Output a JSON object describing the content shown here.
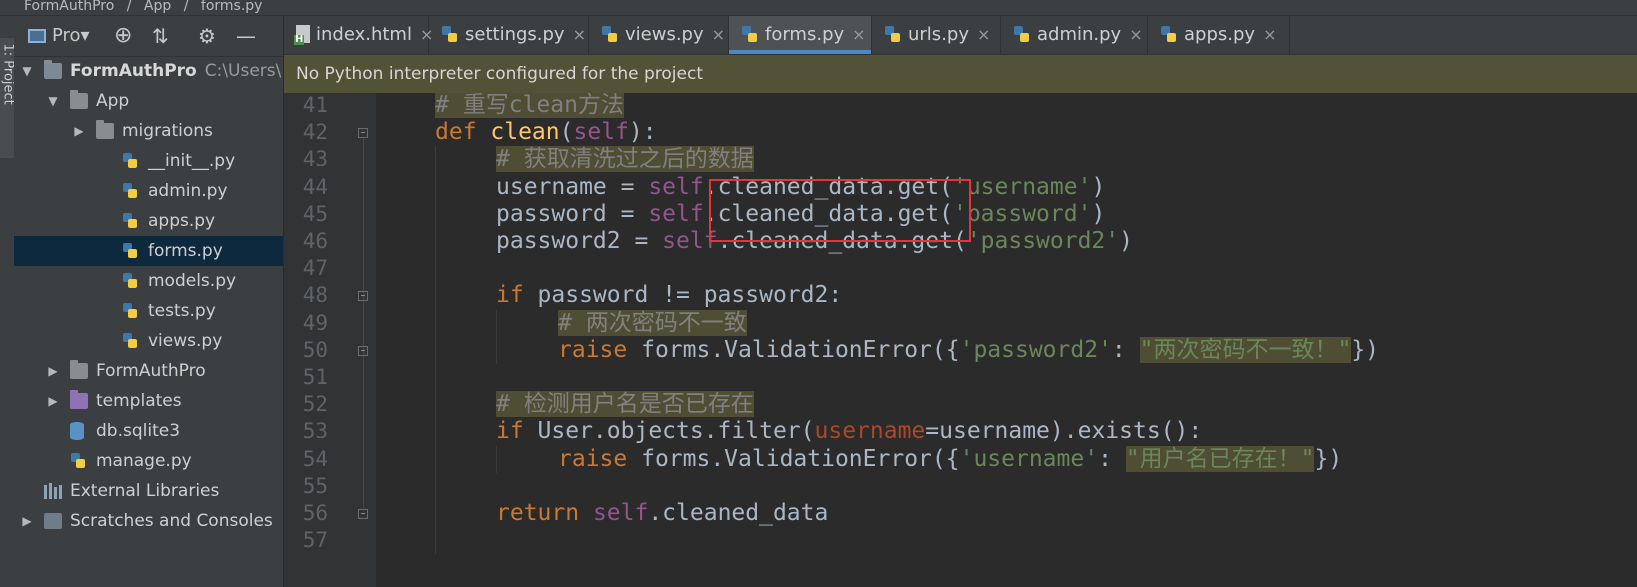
{
  "window": {
    "crumbs": [
      "FormAuthPro",
      "/",
      "App",
      "/",
      "forms.py"
    ]
  },
  "tool_window": {
    "label": "1: Project"
  },
  "sidebar": {
    "view_selector": "Pro▾",
    "tree": [
      {
        "label": "FormAuthPro",
        "suffix": "C:\\Users\\",
        "type": "folder-module",
        "arrow": "▼"
      },
      {
        "label": "App",
        "type": "folder",
        "arrow": "▼"
      },
      {
        "label": "migrations",
        "type": "folder",
        "arrow": "▶"
      },
      {
        "label": "__init__.py",
        "type": "py"
      },
      {
        "label": "admin.py",
        "type": "py"
      },
      {
        "label": "apps.py",
        "type": "py"
      },
      {
        "label": "forms.py",
        "type": "py",
        "selected": true
      },
      {
        "label": "models.py",
        "type": "py"
      },
      {
        "label": "tests.py",
        "type": "py"
      },
      {
        "label": "views.py",
        "type": "py"
      },
      {
        "label": "FormAuthPro",
        "type": "folder",
        "arrow": "▶"
      },
      {
        "label": "templates",
        "type": "folder-purple",
        "arrow": "▶"
      },
      {
        "label": "db.sqlite3",
        "type": "db"
      },
      {
        "label": "manage.py",
        "type": "py"
      },
      {
        "label": "External Libraries",
        "type": "lib"
      },
      {
        "label": "Scratches and Consoles",
        "type": "scratch",
        "arrow": "▶"
      }
    ]
  },
  "tabs": [
    {
      "label": "index.html",
      "icon": "html-icon"
    },
    {
      "label": "settings.py",
      "icon": "python-file-icon"
    },
    {
      "label": "views.py",
      "icon": "python-file-icon"
    },
    {
      "label": "forms.py",
      "icon": "python-file-icon",
      "active": true
    },
    {
      "label": "urls.py",
      "icon": "python-file-icon"
    },
    {
      "label": "admin.py",
      "icon": "python-file-icon"
    },
    {
      "label": "apps.py",
      "icon": "python-file-icon"
    }
  ],
  "tab_close": "×",
  "notice": "No Python interpreter configured for the project",
  "editor": {
    "line_numbers": [
      "41",
      "42",
      "43",
      "44",
      "45",
      "46",
      "47",
      "48",
      "49",
      "50",
      "51",
      "52",
      "53",
      "54",
      "55",
      "56",
      "57"
    ],
    "lines": [
      {
        "t": [
          [
            "# 重写clean方法",
            "cmt"
          ]
        ]
      },
      {
        "t": [
          [
            "def ",
            "kw"
          ],
          [
            "clean",
            "fn"
          ],
          [
            "(",
            ""
          ],
          [
            "self",
            "self"
          ],
          [
            "):",
            ""
          ]
        ]
      },
      {
        "t": [
          [
            "# 获取清洗过之后的数据",
            "cmt"
          ]
        ]
      },
      {
        "t": [
          [
            "username = ",
            ""
          ],
          [
            "self",
            "self"
          ],
          [
            ".cleaned_data.get(",
            ""
          ],
          [
            "'username'",
            "str"
          ],
          [
            ")",
            ""
          ]
        ]
      },
      {
        "t": [
          [
            "password = ",
            ""
          ],
          [
            "self",
            "self"
          ],
          [
            ".cleaned_data.get(",
            ""
          ],
          [
            "'password'",
            "str"
          ],
          [
            ")",
            ""
          ]
        ]
      },
      {
        "t": [
          [
            "password2 = ",
            ""
          ],
          [
            "self",
            "self"
          ],
          [
            ".cleaned_data.get(",
            ""
          ],
          [
            "'password2'",
            "str"
          ],
          [
            ")",
            ""
          ]
        ]
      },
      {
        "t": []
      },
      {
        "t": [
          [
            "if ",
            "kw"
          ],
          [
            "password != password2:",
            ""
          ]
        ]
      },
      {
        "t": [
          [
            "# 两次密码不一致",
            "cmt"
          ]
        ]
      },
      {
        "t": [
          [
            "raise ",
            "kw"
          ],
          [
            "forms.ValidationError({",
            ""
          ],
          [
            "'password2'",
            "str"
          ],
          [
            ": ",
            ""
          ],
          [
            "\"两次密码不一致！\"",
            "strbg"
          ],
          [
            "})",
            ""
          ]
        ]
      },
      {
        "t": []
      },
      {
        "t": [
          [
            "# 检测用户名是否已存在",
            "cmt"
          ]
        ]
      },
      {
        "t": [
          [
            "if ",
            "kw"
          ],
          [
            "User.objects.filter(",
            ""
          ],
          [
            "username",
            "param"
          ],
          [
            "=username).exists():",
            ""
          ]
        ]
      },
      {
        "t": [
          [
            "raise ",
            "kw"
          ],
          [
            "forms.ValidationError({",
            ""
          ],
          [
            "'username'",
            "str"
          ],
          [
            ": ",
            ""
          ],
          [
            "\"用户名已存在！\"",
            "strbg"
          ],
          [
            "})",
            ""
          ]
        ]
      },
      {
        "t": []
      },
      {
        "t": [
          [
            "return ",
            "kw"
          ],
          [
            "self",
            "self"
          ],
          [
            ".cleaned_data",
            ""
          ]
        ]
      },
      {
        "t": []
      }
    ]
  }
}
